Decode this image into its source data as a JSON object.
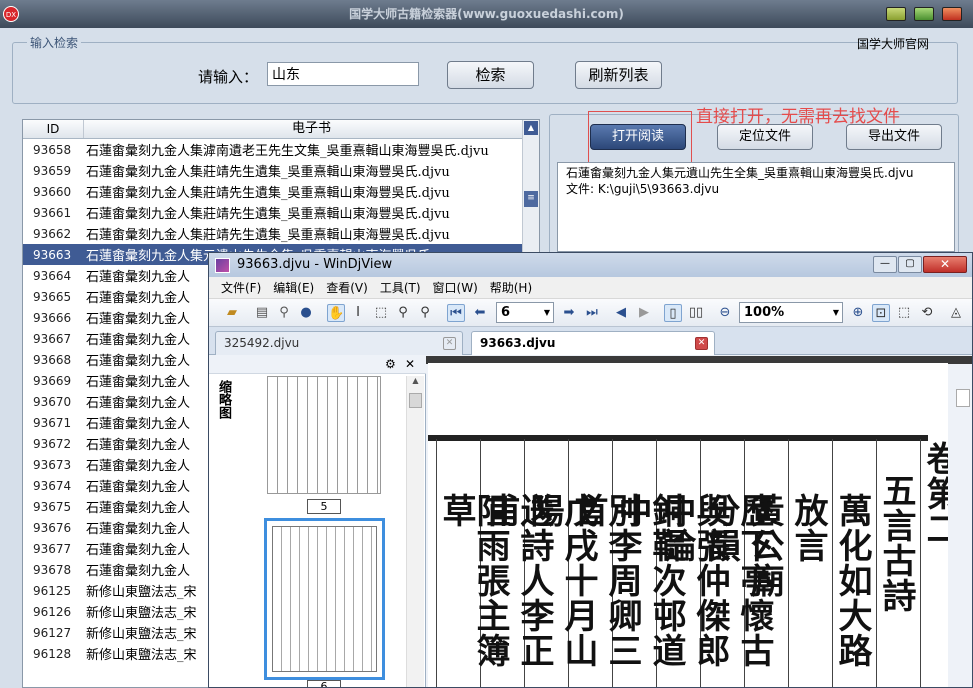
{
  "app": {
    "title": "国学大师古籍检索器(www.guoxuedashi.com)",
    "icon_text": "DX"
  },
  "search": {
    "group_title": "输入检索",
    "label": "请输入：",
    "value": "山东",
    "button": "检索",
    "refresh_button": "刷新列表",
    "site_link": "国学大师官网"
  },
  "list": {
    "col_id": "ID",
    "col_name": "电子书",
    "rows": [
      {
        "id": "93658",
        "name": "石蓮畬彙刻九金人集滹南遺老王先生文集_吳重熹輯山東海豐吳氏.djvu"
      },
      {
        "id": "93659",
        "name": "石蓮畬彙刻九金人集莊靖先生遺集_吳重熹輯山東海豐吳氏.djvu"
      },
      {
        "id": "93660",
        "name": "石蓮畬彙刻九金人集莊靖先生遺集_吳重熹輯山東海豐吳氏.djvu"
      },
      {
        "id": "93661",
        "name": "石蓮畬彙刻九金人集莊靖先生遺集_吳重熹輯山東海豐吳氏.djvu"
      },
      {
        "id": "93662",
        "name": "石蓮畬彙刻九金人集莊靖先生遺集_吳重熹輯山東海豐吳氏.djvu"
      },
      {
        "id": "93663",
        "name": "石蓮畬彙刻九金人集元遺山先生全集_吳重熹輯山東海豐吳氏"
      },
      {
        "id": "93664",
        "name": "石蓮畬彙刻九金人"
      },
      {
        "id": "93665",
        "name": "石蓮畬彙刻九金人"
      },
      {
        "id": "93666",
        "name": "石蓮畬彙刻九金人"
      },
      {
        "id": "93667",
        "name": "石蓮畬彙刻九金人"
      },
      {
        "id": "93668",
        "name": "石蓮畬彙刻九金人"
      },
      {
        "id": "93669",
        "name": "石蓮畬彙刻九金人"
      },
      {
        "id": "93670",
        "name": "石蓮畬彙刻九金人"
      },
      {
        "id": "93671",
        "name": "石蓮畬彙刻九金人"
      },
      {
        "id": "93672",
        "name": "石蓮畬彙刻九金人"
      },
      {
        "id": "93673",
        "name": "石蓮畬彙刻九金人"
      },
      {
        "id": "93674",
        "name": "石蓮畬彙刻九金人"
      },
      {
        "id": "93675",
        "name": "石蓮畬彙刻九金人"
      },
      {
        "id": "93676",
        "name": "石蓮畬彙刻九金人"
      },
      {
        "id": "93677",
        "name": "石蓮畬彙刻九金人"
      },
      {
        "id": "93678",
        "name": "石蓮畬彙刻九金人"
      },
      {
        "id": "96125",
        "name": "新修山東鹽法志_宋"
      },
      {
        "id": "96126",
        "name": "新修山東鹽法志_宋"
      },
      {
        "id": "96127",
        "name": "新修山東鹽法志_宋"
      },
      {
        "id": "96128",
        "name": "新修山東鹽法志_宋"
      }
    ]
  },
  "actions": {
    "open": "打开阅读",
    "locate": "定位文件",
    "export": "导出文件",
    "annotation": "直接打开，无需再去找文件"
  },
  "preview": {
    "line1": "石蓮畬彙刻九金人集元遺山先生全集_吳重熹輯山東海豐吳氏.djvu",
    "line2": "文件: K:\\guji\\5\\93663.djvu"
  },
  "djvu": {
    "title": "93663.djvu - WinDjView",
    "menu": [
      "文件(F)",
      "编辑(E)",
      "查看(V)",
      "工具(T)",
      "窗口(W)",
      "帮助(H)"
    ],
    "page": "6",
    "zoom": "100%",
    "tabs": [
      "325492.djvu",
      "93663.djvu"
    ],
    "sidebar_title": "缩略图",
    "thumb_pages": [
      "5",
      "6"
    ],
    "text_columns": [
      "卷第二",
      "五言古詩",
      "萬化如大路",
      "放言",
      "黃公廟",
      "歷下亭懷古分韻",
      "與張仲傑郎中論",
      "銅鞮次邨道中",
      "別李周卿三首",
      "戊戌十月山陽",
      "送詩人李正甫",
      "阻雨張主簿草"
    ]
  }
}
